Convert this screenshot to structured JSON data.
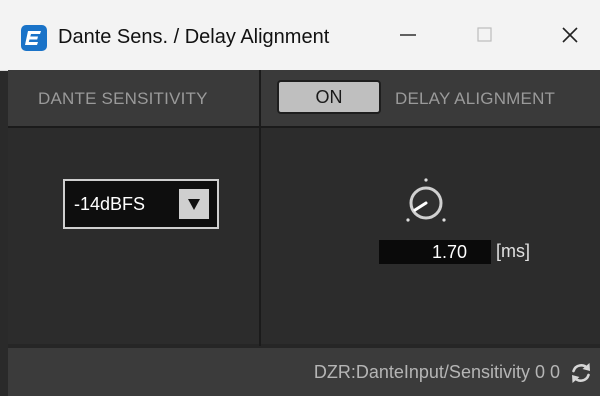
{
  "window": {
    "title": "Dante Sens. / Delay Alignment",
    "controls": {
      "minimize": "minimize-icon",
      "maximize": "maximize-icon",
      "close": "close-icon"
    }
  },
  "left_panel": {
    "header": "DANTE SENSITIVITY",
    "sensitivity_select": {
      "selected": "-14dBFS",
      "arrow_icon": "dropdown-arrow-icon"
    }
  },
  "right_panel": {
    "header": "DELAY ALIGNMENT",
    "on_button": "ON",
    "delay_value": "1.70",
    "delay_unit": "[ms]"
  },
  "status_bar": {
    "text": "DZR:DanteInput/Sensitivity 0 0",
    "refresh_icon": "refresh-icon"
  },
  "colors": {
    "accent": "#1a73c8",
    "panel_bg": "#2c2c2c",
    "header_bg": "#3a3a3a"
  }
}
